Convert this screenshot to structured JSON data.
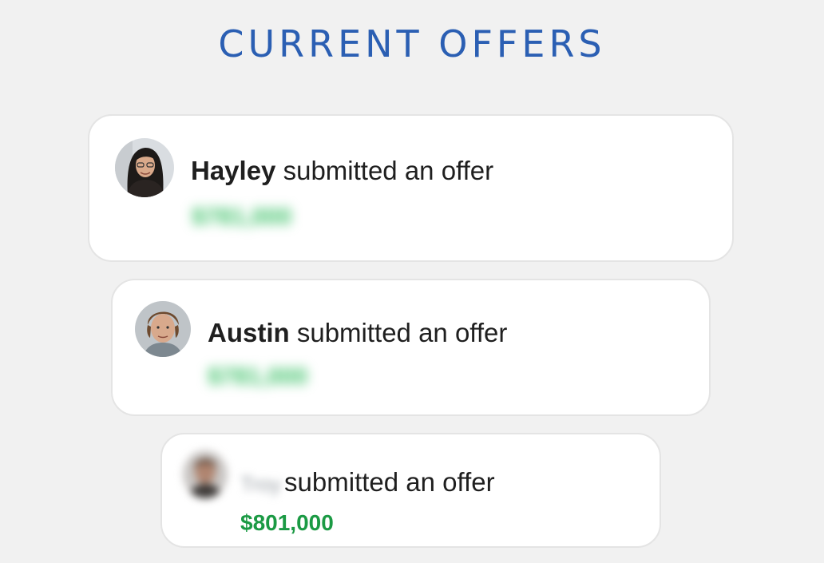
{
  "header": {
    "title": "CURRENT OFFERS"
  },
  "offers": [
    {
      "name": "Hayley",
      "action": " submitted an offer",
      "amount": "$781,000",
      "amount_blurred": true,
      "avatar_icon": "person-photo-icon"
    },
    {
      "name": "Austin",
      "action": " submitted an offer",
      "amount": "$781,000",
      "amount_blurred": true,
      "avatar_icon": "person-photo-icon"
    },
    {
      "name": "Troy",
      "name_blurred": true,
      "action": "submitted an offer",
      "amount": "$801,000",
      "amount_blurred": false,
      "avatar_icon": "person-photo-icon"
    }
  ],
  "colors": {
    "title": "#2b5fb3",
    "amount": "#1b9a44",
    "background": "#f1f1f1",
    "card": "#ffffff"
  }
}
